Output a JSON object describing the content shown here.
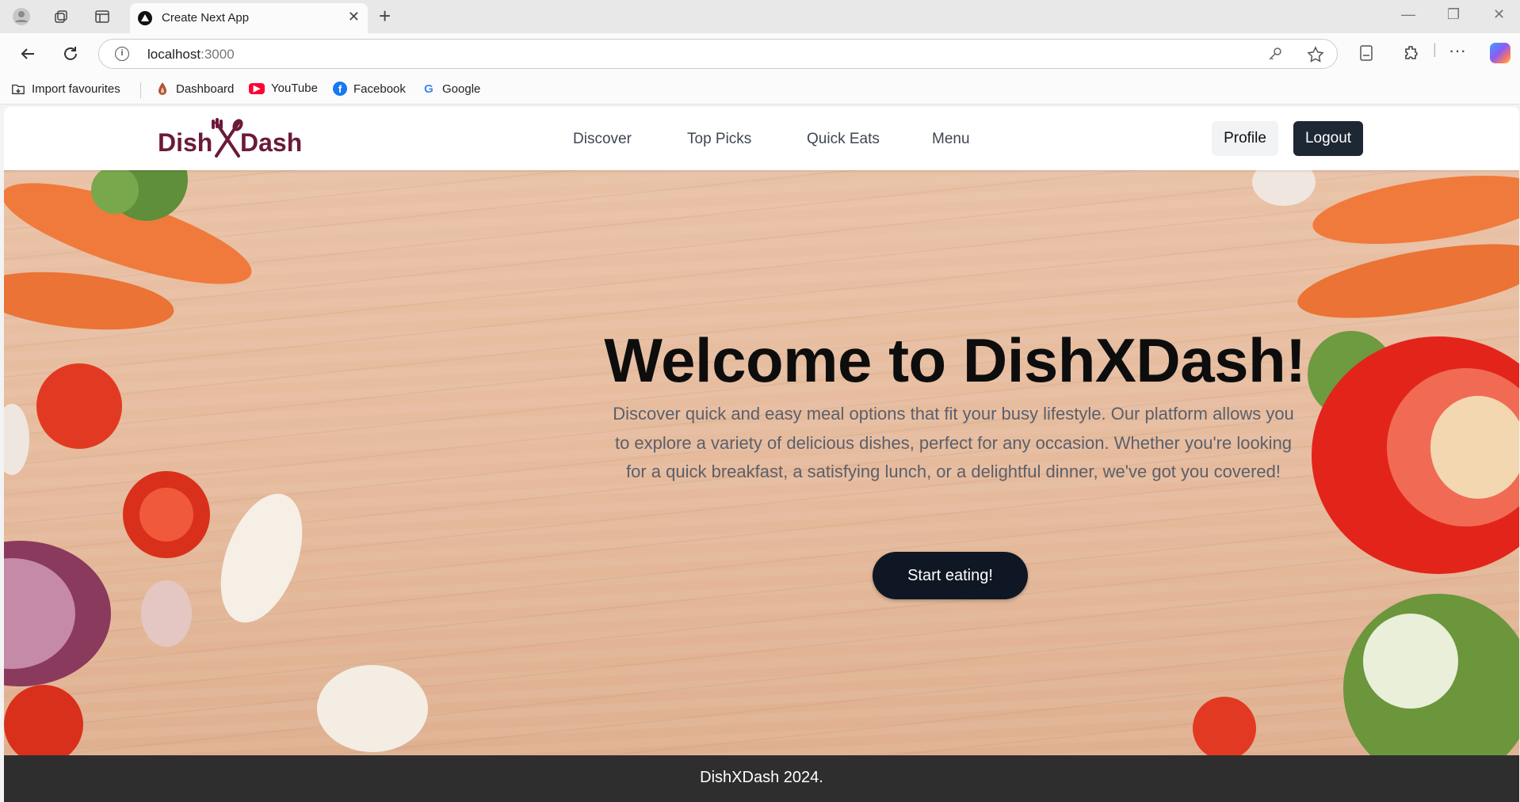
{
  "browser": {
    "tab_title": "Create Next App",
    "url_host": "localhost",
    "url_port": ":3000",
    "bookmarks": [
      {
        "label": "Import favourites",
        "icon": "import-icon"
      },
      {
        "label": "Dashboard",
        "icon": "dashboard-icon"
      },
      {
        "label": "YouTube",
        "icon": "youtube-icon"
      },
      {
        "label": "Facebook",
        "icon": "facebook-icon"
      },
      {
        "label": "Google",
        "icon": "google-icon"
      }
    ]
  },
  "site": {
    "logo_left": "Dish",
    "logo_right": "Dash",
    "nav": [
      "Discover",
      "Top Picks",
      "Quick Eats",
      "Menu"
    ],
    "profile_label": "Profile",
    "logout_label": "Logout"
  },
  "hero": {
    "title": "Welcome to DishXDash!",
    "text": "Discover quick and easy meal options that fit your busy lifestyle. Our platform allows you to explore a variety of delicious dishes, perfect for any occasion. Whether you're looking for a quick breakfast, a satisfying lunch, or a delightful dinner, we've got you covered!",
    "cta_label": "Start eating!"
  },
  "footer": {
    "text": "DishXDash 2024."
  },
  "colors": {
    "brand": "#6b1a3a",
    "dark_button": "#1e2734",
    "cta": "#0f1724",
    "footer_bg": "#2e2e2e"
  }
}
